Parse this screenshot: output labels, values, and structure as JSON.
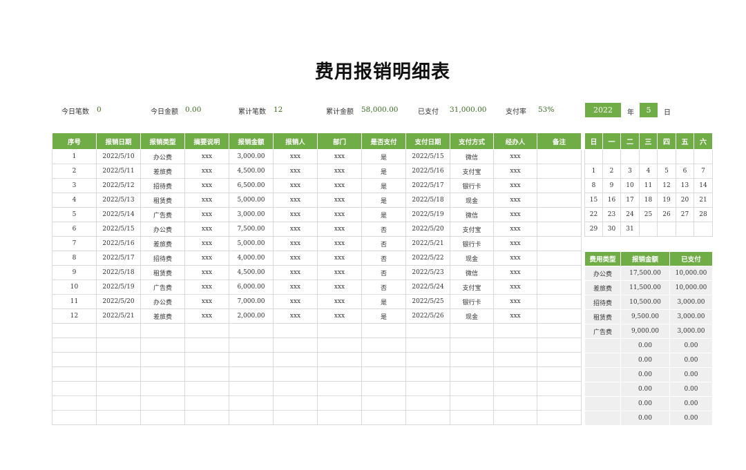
{
  "title": "费用报销明细表",
  "stats": [
    {
      "label": "今日笔数",
      "value": "0"
    },
    {
      "label": "今日金额",
      "value": "0.00"
    },
    {
      "label": "累计笔数",
      "value": "12"
    },
    {
      "label": "累计金额",
      "value": "58,000.00"
    },
    {
      "label": "已支付",
      "value": "31,000.00"
    },
    {
      "label": "支付率",
      "value": "53%"
    }
  ],
  "date_selector": {
    "year": "2022",
    "year_label": "年",
    "month": "5",
    "month_label": "日"
  },
  "main_table": {
    "headers": [
      "序号",
      "报销日期",
      "报销类型",
      "摘要说明",
      "报销金额",
      "报销人",
      "部门",
      "是否支付",
      "支付日期",
      "支付方式",
      "经办人",
      "备注"
    ],
    "rows": [
      [
        "1",
        "2022/5/10",
        "办公费",
        "xxx",
        "3,000.00",
        "xxx",
        "xxx",
        "是",
        "2022/5/15",
        "微信",
        "xxx",
        ""
      ],
      [
        "2",
        "2022/5/11",
        "差旅费",
        "xxx",
        "4,500.00",
        "xxx",
        "xxx",
        "是",
        "2022/5/16",
        "支付宝",
        "xxx",
        ""
      ],
      [
        "3",
        "2022/5/12",
        "招待费",
        "xxx",
        "6,500.00",
        "xxx",
        "xxx",
        "是",
        "2022/5/17",
        "银行卡",
        "xxx",
        ""
      ],
      [
        "4",
        "2022/5/13",
        "租赁费",
        "xxx",
        "5,000.00",
        "xxx",
        "xxx",
        "是",
        "2022/5/18",
        "现金",
        "xxx",
        ""
      ],
      [
        "5",
        "2022/5/14",
        "广告费",
        "xxx",
        "3,000.00",
        "xxx",
        "xxx",
        "是",
        "2022/5/19",
        "微信",
        "xxx",
        ""
      ],
      [
        "6",
        "2022/5/15",
        "办公费",
        "xxx",
        "7,500.00",
        "xxx",
        "xxx",
        "否",
        "2022/5/20",
        "支付宝",
        "xxx",
        ""
      ],
      [
        "7",
        "2022/5/16",
        "差旅费",
        "xxx",
        "5,000.00",
        "xxx",
        "xxx",
        "否",
        "2022/5/21",
        "银行卡",
        "xxx",
        ""
      ],
      [
        "8",
        "2022/5/17",
        "招待费",
        "xxx",
        "4,000.00",
        "xxx",
        "xxx",
        "否",
        "2022/5/22",
        "现金",
        "xxx",
        ""
      ],
      [
        "9",
        "2022/5/18",
        "租赁费",
        "xxx",
        "4,500.00",
        "xxx",
        "xxx",
        "否",
        "2022/5/23",
        "微信",
        "xxx",
        ""
      ],
      [
        "10",
        "2022/5/19",
        "广告费",
        "xxx",
        "6,000.00",
        "xxx",
        "xxx",
        "否",
        "2022/5/24",
        "支付宝",
        "xxx",
        ""
      ],
      [
        "11",
        "2022/5/20",
        "办公费",
        "xxx",
        "7,000.00",
        "xxx",
        "xxx",
        "是",
        "2022/5/25",
        "银行卡",
        "xxx",
        ""
      ],
      [
        "12",
        "2022/5/21",
        "差旅费",
        "xxx",
        "2,000.00",
        "xxx",
        "xxx",
        "是",
        "2022/5/26",
        "现金",
        "xxx",
        ""
      ],
      [
        "",
        "",
        "",
        "",
        "",
        "",
        "",
        "",
        "",
        "",
        "",
        ""
      ],
      [
        "",
        "",
        "",
        "",
        "",
        "",
        "",
        "",
        "",
        "",
        "",
        ""
      ],
      [
        "",
        "",
        "",
        "",
        "",
        "",
        "",
        "",
        "",
        "",
        "",
        ""
      ],
      [
        "",
        "",
        "",
        "",
        "",
        "",
        "",
        "",
        "",
        "",
        "",
        ""
      ],
      [
        "",
        "",
        "",
        "",
        "",
        "",
        "",
        "",
        "",
        "",
        "",
        ""
      ],
      [
        "",
        "",
        "",
        "",
        "",
        "",
        "",
        "",
        "",
        "",
        "",
        ""
      ],
      [
        "",
        "",
        "",
        "",
        "",
        "",
        "",
        "",
        "",
        "",
        "",
        ""
      ]
    ]
  },
  "calendar": {
    "headers": [
      "日",
      "一",
      "二",
      "三",
      "四",
      "五",
      "六"
    ],
    "rows": [
      [
        "",
        "",
        "",
        "",
        "",
        "",
        ""
      ],
      [
        "1",
        "2",
        "3",
        "4",
        "5",
        "6",
        "7"
      ],
      [
        "8",
        "9",
        "10",
        "11",
        "12",
        "13",
        "14"
      ],
      [
        "15",
        "16",
        "17",
        "18",
        "19",
        "20",
        "21"
      ],
      [
        "22",
        "23",
        "24",
        "25",
        "26",
        "27",
        "28"
      ],
      [
        "29",
        "30",
        "31",
        "",
        "",
        "",
        ""
      ]
    ]
  },
  "summary_table": {
    "headers": [
      "费用类型",
      "报销金额",
      "已支付"
    ],
    "rows": [
      [
        "办公费",
        "17,500.00",
        "10,000.00"
      ],
      [
        "差旅费",
        "11,500.00",
        "10,000.00"
      ],
      [
        "招待费",
        "10,500.00",
        "3,000.00"
      ],
      [
        "租赁费",
        "9,500.00",
        "3,000.00"
      ],
      [
        "广告费",
        "9,000.00",
        "3,000.00"
      ],
      [
        "",
        "0.00",
        "0.00"
      ],
      [
        "",
        "0.00",
        "0.00"
      ],
      [
        "",
        "0.00",
        "0.00"
      ],
      [
        "",
        "0.00",
        "0.00"
      ],
      [
        "",
        "0.00",
        "0.00"
      ],
      [
        "",
        "0.00",
        "0.00"
      ]
    ]
  }
}
